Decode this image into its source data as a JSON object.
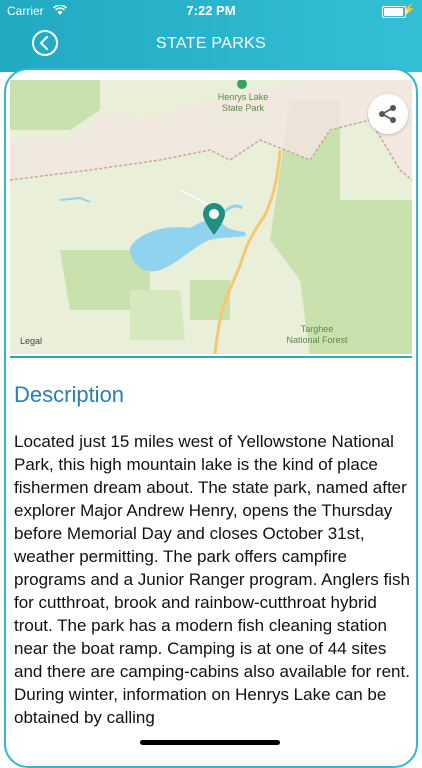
{
  "status_bar": {
    "carrier": "Carrier",
    "time": "7:22 PM"
  },
  "header": {
    "title": "STATE PARKS"
  },
  "map": {
    "labels": {
      "park": "Henrys Lake\nState Park",
      "forest": "Targhee\nNational Forest",
      "legal": "Legal"
    },
    "colors": {
      "land": "#e9efd8",
      "forest": "#c9e2ad",
      "water": "#8fd3ee",
      "road": "#f4c873",
      "pin": "#1f8f80"
    }
  },
  "description": {
    "heading": "Description",
    "body": "Located just 15 miles west of Yellowstone National Park, this high mountain lake is the kind of place fishermen dream about. The state park, named after explorer Major Andrew Henry, opens the Thursday before Memorial Day and closes October 31st, weather permitting. The park offers campfire programs and a Junior Ranger program. Anglers fish for cutthroat, brook and rainbow-cutthroat hybrid trout. The park has a modern fish cleaning station near the boat ramp. Camping is at one of 44 sites and there are camping-cabins also available for rent. During winter, information on Henrys Lake can be obtained by calling"
  }
}
